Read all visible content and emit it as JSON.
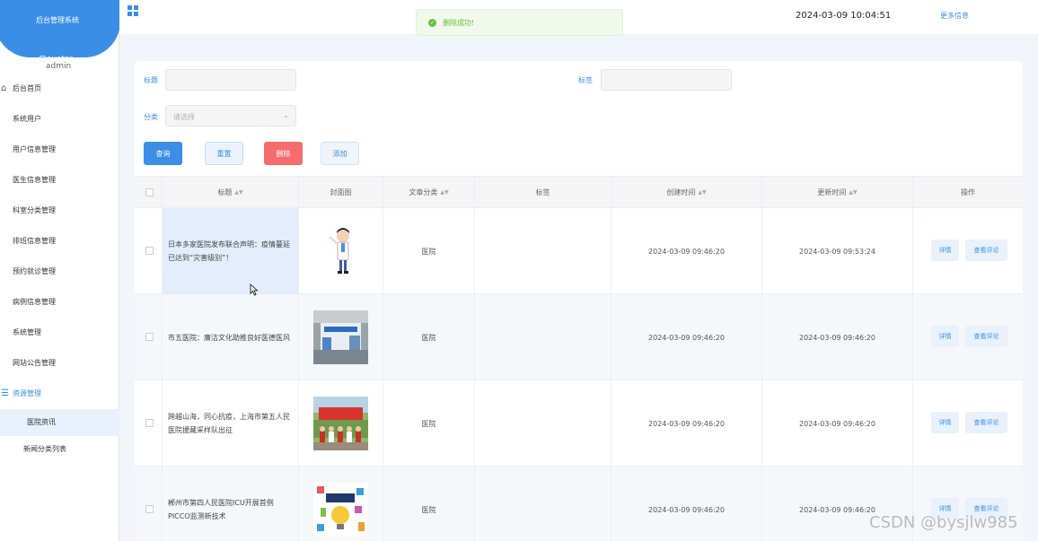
{
  "app": {
    "brand_title": "后台管理系统",
    "avatar_alt": "avatar",
    "user": "admin"
  },
  "sidebar": {
    "home": "后台首页",
    "items": [
      {
        "label": "系统用户"
      },
      {
        "label": "用户信息管理"
      },
      {
        "label": "医生信息管理"
      },
      {
        "label": "科室分类管理"
      },
      {
        "label": "排班信息管理"
      },
      {
        "label": "预约就诊管理"
      },
      {
        "label": "病例信息管理"
      },
      {
        "label": "系统管理"
      },
      {
        "label": "网站公告管理"
      }
    ],
    "group": {
      "label": "资源管理",
      "children": [
        "医院资讯",
        "新闻分类列表"
      ]
    }
  },
  "topbar": {
    "datetime": "2024-03-09 10:04:51",
    "more": "更多信息"
  },
  "toast": {
    "text": "删除成功!",
    "icon": "success-check-icon",
    "color": "#67c23a"
  },
  "search": {
    "title_label": "标题",
    "title_value": "",
    "tag_label": "标签",
    "tag_value": "",
    "category_label": "分类",
    "category_placeholder": "请选择"
  },
  "buttons": {
    "query": "查询",
    "reset": "重置",
    "delete": "删除",
    "add": "添加"
  },
  "table": {
    "headers": [
      "标题",
      "封面图",
      "文章分类",
      "标签",
      "创建时间",
      "更新时间",
      "操作"
    ],
    "row_actions": {
      "detail": "详情",
      "comments": "查看评论"
    },
    "rows": [
      {
        "title": "日本多家医院发布联合声明：疫情蔓延已达到“灾害级别”！",
        "category": "医院",
        "tag": "",
        "created": "2024-03-09 09:46:20",
        "updated": "2024-03-09 09:53:24"
      },
      {
        "title": "市五医院：廉洁文化助推良好医德医风",
        "category": "医院",
        "tag": "",
        "created": "2024-03-09 09:46:20",
        "updated": "2024-03-09 09:46:20"
      },
      {
        "title": "跨越山海，同心抗疫，上海市第五人民医院援藏采样队出征",
        "category": "医院",
        "tag": "",
        "created": "2024-03-09 09:46:20",
        "updated": "2024-03-09 09:46:20"
      },
      {
        "title": "郴州市第四人民医院ICU开展首例PICCO监测新技术",
        "category": "医院",
        "tag": "",
        "created": "2024-03-09 09:46:20",
        "updated": "2024-03-09 09:46:20"
      }
    ]
  },
  "colors": {
    "primary": "#3a8ee6",
    "danger": "#f56c6c",
    "success": "#67c23a"
  },
  "watermark": "CSDN @bysjlw985"
}
